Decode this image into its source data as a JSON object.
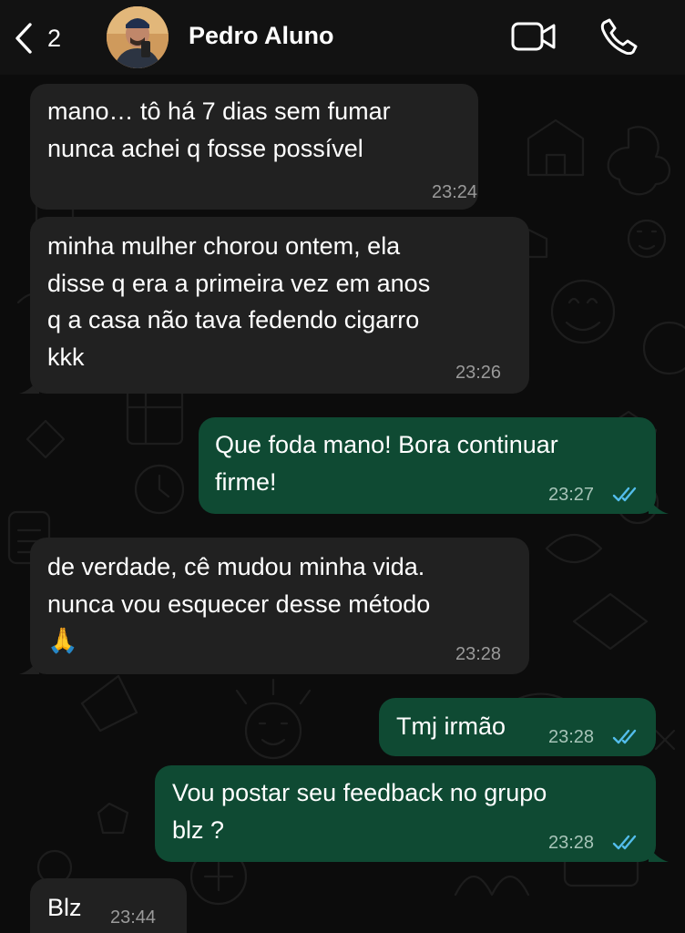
{
  "header": {
    "back_count": "2",
    "contact_name": "Pedro Aluno",
    "back_icon": "chevron-left-icon",
    "video_icon": "video-camera-icon",
    "call_icon": "phone-icon"
  },
  "colors": {
    "incoming_bubble": "#212121",
    "outgoing_bubble": "#0f4a33",
    "read_ticks": "#53bdeb",
    "background": "#0c0c0c"
  },
  "messages": [
    {
      "direction": "incoming",
      "text": "mano… tô há 7 dias sem fumar\nnunca achei q fosse possível",
      "time": "23:24"
    },
    {
      "direction": "incoming",
      "text": "minha mulher chorou ontem, ela\ndisse q era a primeira vez em anos\nq a casa não tava fedendo cigarro\nkkk",
      "time": "23:26"
    },
    {
      "direction": "outgoing",
      "text": "Que foda mano! Bora continuar\nfirme!",
      "time": "23:27",
      "status": "read"
    },
    {
      "direction": "incoming",
      "text": "de verdade, cê mudou minha vida.\nnunca vou esquecer desse método\n🙏",
      "time": "23:28"
    },
    {
      "direction": "outgoing",
      "text": "Tmj irmão",
      "time": "23:28",
      "status": "read"
    },
    {
      "direction": "outgoing",
      "text": "Vou postar seu feedback no grupo\nblz ?",
      "time": "23:28",
      "status": "read"
    },
    {
      "direction": "incoming",
      "text": "Blz",
      "time": "23:44"
    }
  ]
}
